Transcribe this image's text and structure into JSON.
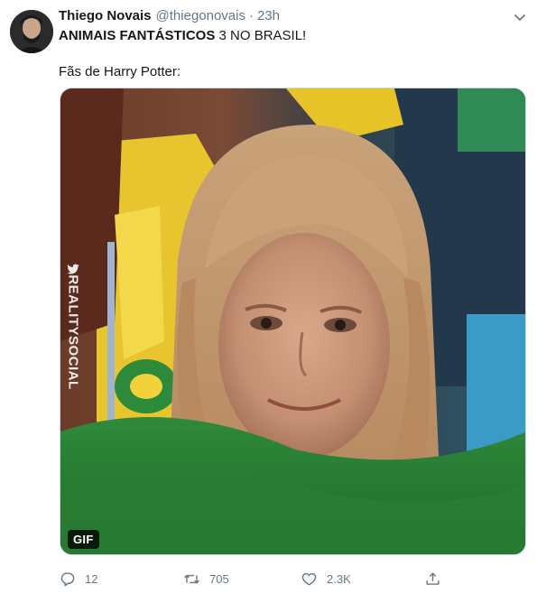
{
  "tweet": {
    "author_name": "Thiego Novais",
    "handle": "@thiegonovais",
    "separator": "·",
    "time": "23h",
    "text_bold": "ANIMAIS FANTÁSTICOS",
    "text_rest": " 3 NO BRASIL!",
    "text_line2": "Fãs de Harry Potter:"
  },
  "media": {
    "badge": "GIF",
    "watermark": "REALITYSOCIAL"
  },
  "actions": {
    "replies": "12",
    "retweets": "705",
    "likes": "2.3K"
  },
  "colors": {
    "muted": "#657786",
    "text": "#14171a",
    "border": "#ccd6dd"
  },
  "icons": [
    "chevron-down-icon",
    "reply-icon",
    "retweet-icon",
    "like-icon",
    "share-icon",
    "twitter-bird-icon"
  ]
}
